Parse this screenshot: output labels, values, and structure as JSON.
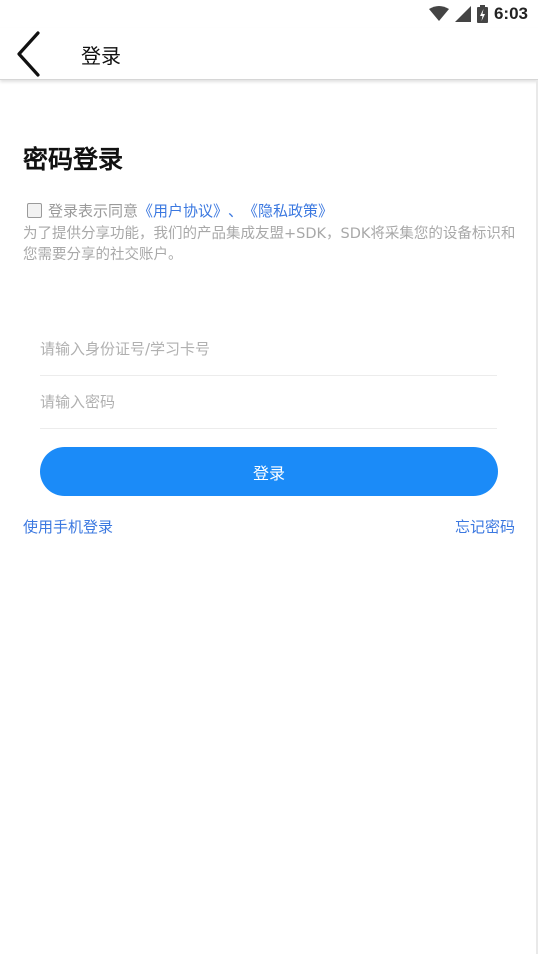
{
  "status_bar": {
    "time": "6:03"
  },
  "app_bar": {
    "title": "登录"
  },
  "main": {
    "page_title": "密码登录",
    "agreement": {
      "prefix": "登录表示同意",
      "user_agreement": "《用户协议》",
      "separator": "、",
      "privacy_policy": "《隐私政策》"
    },
    "sdk_notice": "为了提供分享功能，我们的产品集成友盟+SDK，SDK将采集您的设备标识和您需要分享的社交账户。",
    "id_field": {
      "value": "",
      "placeholder": "请输入身份证号/学习卡号"
    },
    "password_field": {
      "value": "",
      "placeholder": "请输入密码"
    },
    "login_button": "登录",
    "phone_login_link": "使用手机登录",
    "forgot_password_link": "忘记密码"
  },
  "colors": {
    "primary": "#1b8bf8",
    "link": "#3b78e0",
    "hint": "#a8a8a8"
  },
  "icons": {
    "back": "chevron-left-icon",
    "wifi": "wifi-icon",
    "signal": "signal-icon",
    "battery": "battery-icon"
  }
}
